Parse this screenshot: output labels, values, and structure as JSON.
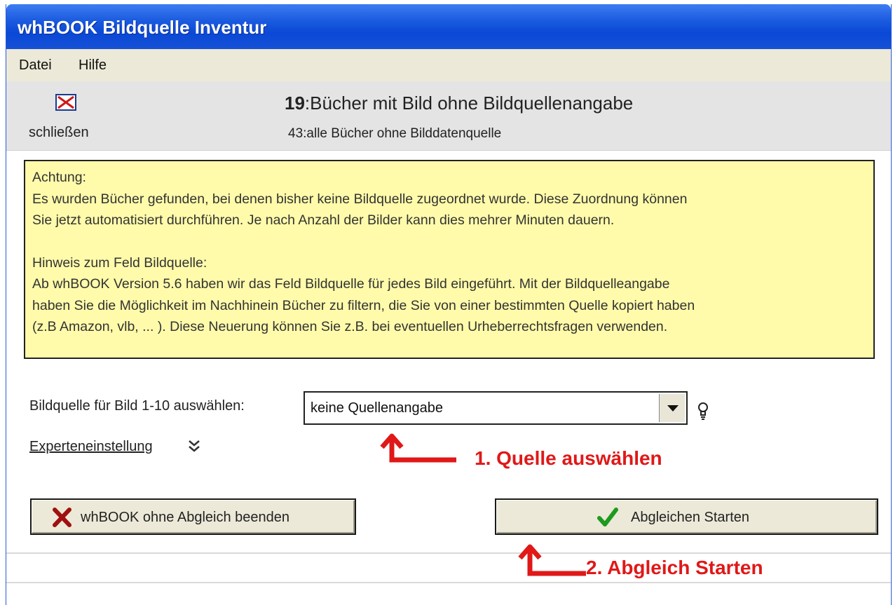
{
  "window": {
    "title": "whBOOK Bildquelle Inventur"
  },
  "menu": {
    "items": [
      {
        "label": "Datei"
      },
      {
        "label": "Hilfe"
      }
    ]
  },
  "header": {
    "close_label": "schließen",
    "count_main_number": "19",
    "count_main_text": ":Bücher mit Bild ohne Bildquellenangabe",
    "count_sub": "43:alle Bücher ohne Bilddatenquelle"
  },
  "notice": {
    "line1": "Achtung:",
    "line2": "Es wurden Bücher gefunden, bei denen bisher keine Bildquelle zugeordnet wurde. Diese Zuordnung können",
    "line3": "Sie jetzt automatisiert durchführen. Je nach Anzahl der Bilder kann dies mehrer Minuten dauern.",
    "line4": "Hinweis zum Feld Bildquelle:",
    "line5": "Ab whBOOK Version 5.6 haben wir das Feld Bildquelle für jedes Bild eingeführt. Mit der Bildquelleangabe",
    "line6": "haben Sie die Möglichkeit im Nachhinein Bücher zu filtern, die Sie von einer bestimmten Quelle kopiert haben",
    "line7": "(z.B Amazon, vlb, ... ). Diese Neuerung können Sie z.B. bei eventuellen Urheberrechtsfragen verwenden."
  },
  "source": {
    "label": "Bildquelle für Bild 1-10 auswählen:",
    "selected": "keine Quellenangabe"
  },
  "expert": {
    "label": "Experteneinstellung"
  },
  "buttons": {
    "quit": "whBOOK ohne Abgleich beenden",
    "start": "Abgleichen Starten"
  },
  "annotations": {
    "step1": "1. Quelle auswählen",
    "step2": "2. Abgleich Starten",
    "color": "#e01818"
  },
  "icons": {
    "close": "close-icon",
    "bulb": "lightbulb-icon",
    "chevron": "double-chevron-down-icon",
    "quit": "red-x-icon",
    "start": "green-check-icon"
  }
}
